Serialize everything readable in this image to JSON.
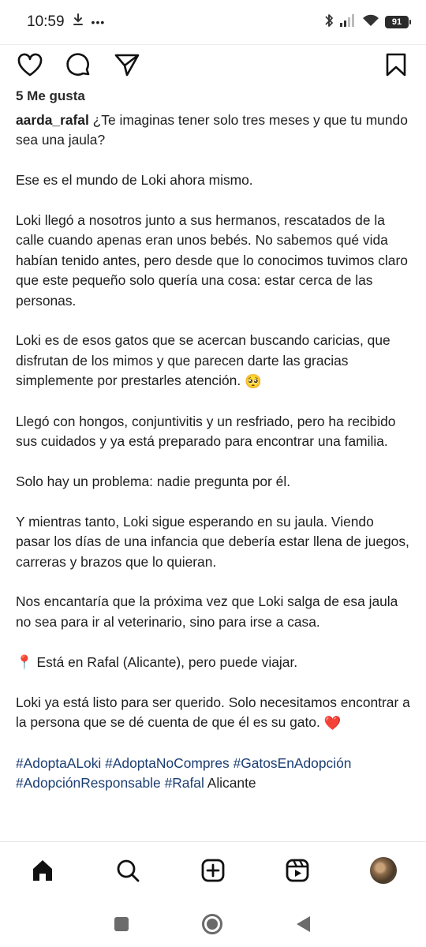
{
  "status_bar": {
    "time": "10:59",
    "more": "•••",
    "battery": "91",
    "icons": [
      "download-icon",
      "bluetooth-icon",
      "cell-signal-icon",
      "wifi-icon",
      "battery-icon"
    ]
  },
  "post": {
    "likes": "5 Me gusta",
    "username": "aarda_rafal",
    "paragraphs": [
      "¿Te imaginas tener solo tres meses y que tu mundo sea una jaula?",
      "Ese es el mundo de Loki ahora mismo.",
      "Loki llegó a nosotros junto a sus hermanos, rescatados de la calle cuando apenas eran unos bebés. No sabemos qué vida habían tenido antes, pero desde que lo conocimos tuvimos claro que este pequeño solo quería una cosa: estar cerca de las personas.",
      "Loki es de esos gatos que se acercan buscando caricias, que disfrutan de los mimos y que parecen darte las gracias simplemente por prestarles atención.",
      "Llegó con hongos, conjuntivitis y un resfriado, pero ha recibido sus cuidados y ya está preparado para encontrar una familia.",
      "Solo hay un problema: nadie pregunta por él.",
      "Y mientras tanto, Loki sigue esperando en su jaula. Viendo pasar los días de una infancia que debería estar llena de juegos, carreras y brazos que lo quieran.",
      "Nos encantaría que la próxima vez que Loki salga de esa jaula no sea para ir al veterinario, sino para irse a casa.",
      "Está en Rafal (Alicante), pero puede viajar.",
      "Loki ya está listo para ser querido. Solo necesitamos encontrar a la persona que se dé cuenta de que él es su gato."
    ],
    "hashtags": [
      "#AdoptaALoki",
      "#AdoptaNoCompres",
      "#GatosEnAdopción",
      "#AdopciónResponsable",
      "#Rafal"
    ],
    "trailing_text": "Alicante",
    "emojis": {
      "pleading": "🥺",
      "pin": "📍",
      "heart": "❤️"
    }
  },
  "actions": [
    "heart-icon",
    "comment-icon",
    "share-icon",
    "bookmark-icon"
  ],
  "bottom_nav": [
    "home-icon",
    "search-icon",
    "create-icon",
    "reels-icon",
    "profile-avatar"
  ],
  "system_nav": [
    "recents-button",
    "home-button",
    "back-button"
  ],
  "colors": {
    "hashtag": "#1b3e73",
    "text": "#1e1e1e"
  }
}
